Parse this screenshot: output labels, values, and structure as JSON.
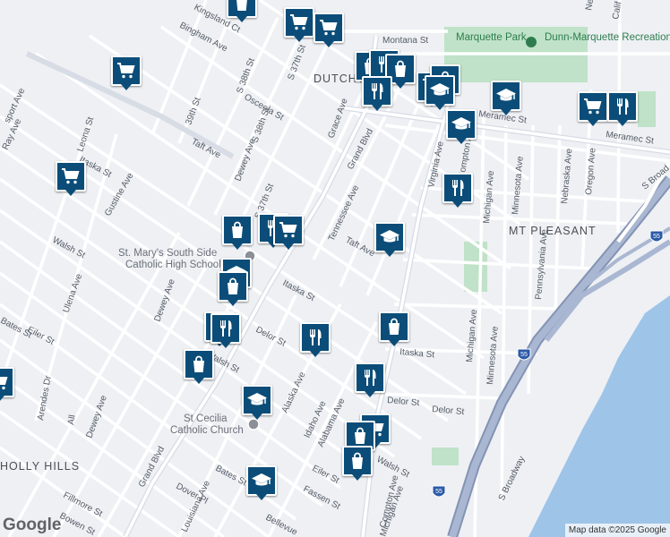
{
  "map": {
    "attribution": "Map data ©2025 Google",
    "logo": "Google",
    "colors": {
      "marker": "#0b4d78",
      "water": "#9ec4e8",
      "park": "#bfe2c8",
      "highway": "#98a8c6",
      "street": "#ffffff",
      "land": "#eef0f4"
    },
    "neighborhoods": [
      {
        "id": "dutchtown",
        "text": "DUTCHTOWN"
      },
      {
        "id": "mt-pleasant",
        "text": "MT PLEASANT"
      },
      {
        "id": "holly-hills",
        "text": "HOLLY HILLS"
      }
    ],
    "places": [
      {
        "id": "marquette-park",
        "text": "Marquette Park",
        "kind": "park"
      },
      {
        "id": "dunn-marquette",
        "text": "Dunn-Marquette Recreation Center",
        "kind": "park"
      },
      {
        "id": "st-marys",
        "line1": "St. Mary's South Side",
        "line2": "Catholic High School",
        "kind": "poi"
      },
      {
        "id": "st-cecilia",
        "line1": "St Cecilia",
        "line2": "Catholic Church",
        "kind": "poi"
      }
    ],
    "streets": {
      "montana": "Montana St",
      "bingham": "Bingham Ave",
      "kingsland": "Kingsland Ct",
      "osceola": "Osceola St",
      "s39th": "39th St",
      "s38th_a": "S 38th St",
      "s38th_b": "S 38th St",
      "s37th_a": "S 37th St",
      "s37th_b": "S 37th St",
      "taft_w": "Taft Ave",
      "taft_e": "Taft Ave",
      "dewey_n": "Dewey Ave",
      "dewey_s": "Dewey Ave",
      "dewey_w": "Dewey Ave",
      "grace": "Grace Ave",
      "grand_n": "Grand Blvd",
      "grand_s": "Grand Blvd",
      "meramec_w": "Meramec St",
      "meramec_e": "Meramec St",
      "virginia": "Virginia Ave",
      "compton_n": "Compton Ave",
      "compton_s": "Compton Ave",
      "michigan_n": "Michigan Ave",
      "michigan_m": "Michigan Ave",
      "michigan_s": "Michigan Ave",
      "minnesota_n": "Minnesota Ave",
      "minnesota_s": "Minnesota Ave",
      "nebraska": "Nebraska Ave",
      "oregon": "Oregon Ave",
      "pennsylvania": "Pennsylvania Ave",
      "s_broadway": "S Broadway",
      "s_broad_n": "S Broad",
      "tennessee": "Tennessee Ave",
      "itaska_w": "Itaska St",
      "itaska_m": "Itaska St",
      "itaska_e": "Itaska St",
      "gustine": "Gustine Ave",
      "leona": "Leona St",
      "ray": "Ray Ave",
      "sport": "sport Ave",
      "walsh_w": "Walsh St",
      "walsh_m": "Walsh St",
      "walsh_e": "Walsh St",
      "ulena": "Ulena Ave",
      "eiler_w": "Eiler St",
      "eiler_e": "Eiler St",
      "bates_w": "Bates St",
      "bates_e": "Bates St",
      "delor_w": "Delor St",
      "delor_m": "Delor St",
      "delor_e": "Delor St",
      "alaska": "Alaska Ave",
      "idaho": "Idaho Ave",
      "alabama": "Alabama Ave",
      "arendes": "Arendes Dr",
      "all": "All",
      "louisiana": "Louisiana Ave",
      "fillmore": "Fillmore St",
      "bowen": "Bowen St",
      "dover": "Dover Pl",
      "fassen": "Fassen St",
      "bellevue": "Bellevue",
      "cal": "Calif",
      "nev": "Neva"
    },
    "highway_shields": [
      "55",
      "55",
      "55"
    ],
    "markers": [
      {
        "id": "m1",
        "icon": "shopping-bag-icon"
      },
      {
        "id": "m2",
        "icon": "shopping-cart-icon"
      },
      {
        "id": "m3",
        "icon": "shopping-cart-icon"
      },
      {
        "id": "m4",
        "icon": "shopping-bag-icon"
      },
      {
        "id": "m5",
        "icon": "restaurant-icon"
      },
      {
        "id": "m6",
        "icon": "restaurant-icon"
      },
      {
        "id": "m7",
        "icon": "shopping-bag-icon"
      },
      {
        "id": "m8",
        "icon": "shopping-bag-icon"
      },
      {
        "id": "m9",
        "icon": "graduation-cap-icon"
      },
      {
        "id": "m10",
        "icon": "shopping-cart-icon"
      },
      {
        "id": "m11",
        "icon": "graduation-cap-icon"
      },
      {
        "id": "m12",
        "icon": "shopping-cart-icon"
      },
      {
        "id": "m13",
        "icon": "graduation-cap-icon"
      },
      {
        "id": "m14",
        "icon": "shopping-cart-icon"
      },
      {
        "id": "m15",
        "icon": "restaurant-icon"
      },
      {
        "id": "m16",
        "icon": "graduation-cap-icon"
      },
      {
        "id": "m17",
        "icon": "restaurant-icon"
      },
      {
        "id": "m18",
        "icon": "shopping-cart-icon"
      },
      {
        "id": "m19",
        "icon": "graduation-cap-icon"
      },
      {
        "id": "m20",
        "icon": "shopping-bag-icon"
      },
      {
        "id": "m21",
        "icon": "restaurant-icon"
      },
      {
        "id": "m22",
        "icon": "restaurant-icon"
      },
      {
        "id": "m23",
        "icon": "shopping-cart-icon"
      },
      {
        "id": "m24",
        "icon": "restaurant-icon"
      },
      {
        "id": "m25",
        "icon": "shopping-bag-icon"
      },
      {
        "id": "m26",
        "icon": "restaurant-icon"
      },
      {
        "id": "m27",
        "icon": "graduation-cap-icon"
      },
      {
        "id": "m28",
        "icon": "shopping-cart-icon"
      },
      {
        "id": "m29",
        "icon": "shopping-bag-icon"
      },
      {
        "id": "m30",
        "icon": "shopping-bag-icon"
      },
      {
        "id": "m31",
        "icon": "graduation-cap-icon"
      },
      {
        "id": "m32",
        "icon": "shopping-cart-icon"
      }
    ]
  }
}
